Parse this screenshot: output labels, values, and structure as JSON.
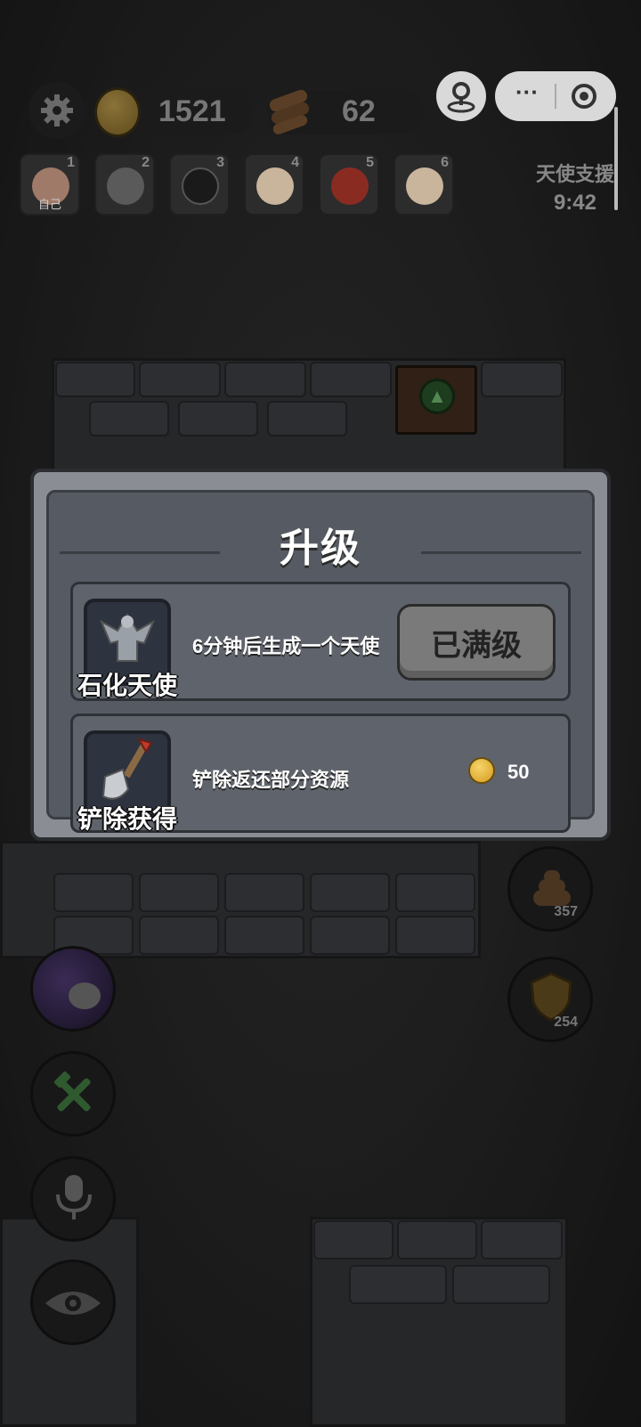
{
  "hud": {
    "coins": "1521",
    "wood": "62",
    "angel_support_label": "天使支援",
    "timer": "9:42"
  },
  "players": [
    {
      "num": "1",
      "tag": "自己",
      "color": "#a07a68"
    },
    {
      "num": "2",
      "tag": "",
      "color": "#5a5a5a"
    },
    {
      "num": "3",
      "tag": "",
      "color": "#1a1a1a"
    },
    {
      "num": "4",
      "tag": "",
      "color": "#c9b49c"
    },
    {
      "num": "5",
      "tag": "",
      "color": "#8a2b22"
    },
    {
      "num": "6",
      "tag": "",
      "color": "#c9b49c"
    }
  ],
  "modal": {
    "title": "升级",
    "rows": [
      {
        "label": "石化天使",
        "desc": "6分钟后生成一个天使",
        "button": "已满级"
      },
      {
        "label": "铲除获得",
        "desc": "铲除返还部分资源",
        "cost": "50"
      }
    ]
  },
  "side": {
    "poop_count": "357",
    "shield_count": "254"
  },
  "colors": {
    "modal_frame": "#8a8e94",
    "modal_panel": "#565b63",
    "button_disabled": "#7a7a7a",
    "coin": "#e2b23a"
  },
  "icons": [
    "gear-icon",
    "coin-icon",
    "wood-icon",
    "menu-dots-icon",
    "record-icon",
    "location-icon",
    "angel-statue-icon",
    "shovel-icon",
    "poop-icon",
    "shield-icon",
    "hammer-wrench-icon",
    "microphone-icon",
    "eye-icon",
    "sheep-avatar-icon"
  ]
}
